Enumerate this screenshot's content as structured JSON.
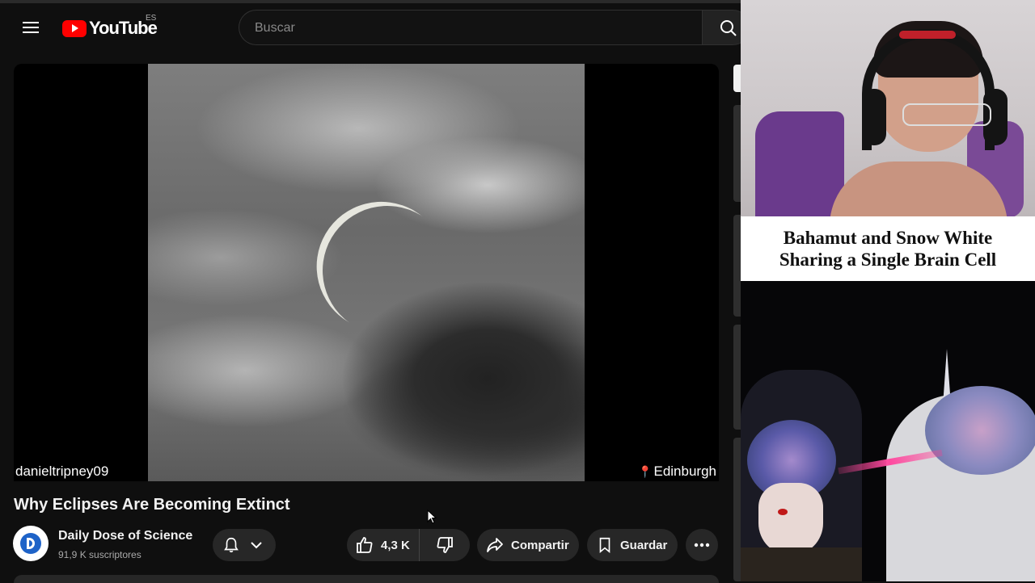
{
  "header": {
    "logo_text": "YouTube",
    "country": "ES",
    "search_placeholder": "Buscar"
  },
  "video": {
    "uploader_overlay": "danieltripney09",
    "location_overlay": "Edinburgh",
    "title": "Why Eclipses Are Becoming Extinct"
  },
  "channel": {
    "name": "Daily Dose of Science",
    "subscribers": "91,9 K suscriptores"
  },
  "actions": {
    "likes": "4,3 K",
    "share": "Compartir",
    "save": "Guardar"
  },
  "thumbnail": {
    "line1": "Bahamut and Snow White",
    "line2": "Sharing a Single Brain Cell"
  },
  "colors": {
    "background": "#0f0f0f",
    "brand_red": "#ff0000",
    "pill": "#272727"
  }
}
